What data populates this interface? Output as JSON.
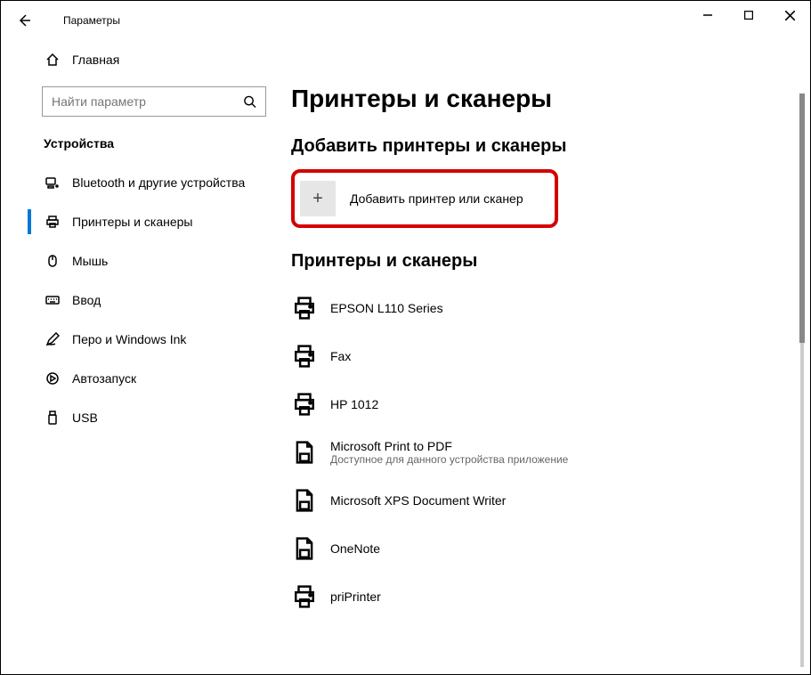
{
  "window": {
    "title": "Параметры"
  },
  "sidebar": {
    "home": "Главная",
    "search_placeholder": "Найти параметр",
    "category": "Устройства",
    "items": [
      {
        "label": "Bluetooth и другие устройства"
      },
      {
        "label": "Принтеры и сканеры"
      },
      {
        "label": "Мышь"
      },
      {
        "label": "Ввод"
      },
      {
        "label": "Перо и Windows Ink"
      },
      {
        "label": "Автозапуск"
      },
      {
        "label": "USB"
      }
    ]
  },
  "main": {
    "title": "Принтеры и сканеры",
    "section_add": "Добавить принтеры и сканеры",
    "add_button": "Добавить принтер или сканер",
    "section_list": "Принтеры и сканеры",
    "printers": [
      {
        "name": "EPSON L110 Series",
        "sub": ""
      },
      {
        "name": "Fax",
        "sub": ""
      },
      {
        "name": "HP 1012",
        "sub": ""
      },
      {
        "name": "Microsoft Print to PDF",
        "sub": "Доступное для данного устройства приложение"
      },
      {
        "name": "Microsoft XPS Document Writer",
        "sub": ""
      },
      {
        "name": "OneNote",
        "sub": ""
      },
      {
        "name": "priPrinter",
        "sub": ""
      }
    ]
  }
}
